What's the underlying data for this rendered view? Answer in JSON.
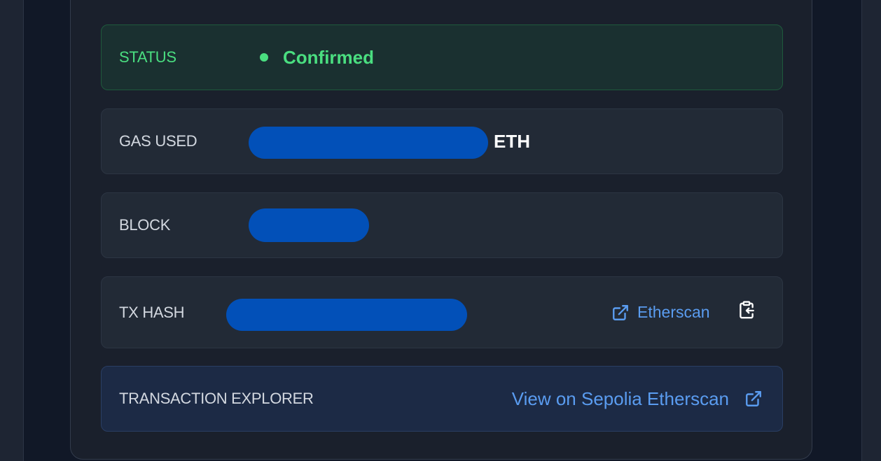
{
  "transaction": {
    "status": {
      "label": "STATUS",
      "value": "Confirmed"
    },
    "gas_used": {
      "label": "GAS USED",
      "unit": "ETH"
    },
    "block": {
      "label": "BLOCK"
    },
    "tx_hash": {
      "label": "TX HASH",
      "etherscan_link": "Etherscan"
    },
    "explorer": {
      "label": "TRANSACTION EXPLORER",
      "link_text": "View on Sepolia Etherscan"
    }
  },
  "colors": {
    "success": "#4ade80",
    "link": "#5a9cf0",
    "redaction": "#0250b8"
  },
  "icons": [
    "external-link-icon",
    "clipboard-copy-icon"
  ]
}
